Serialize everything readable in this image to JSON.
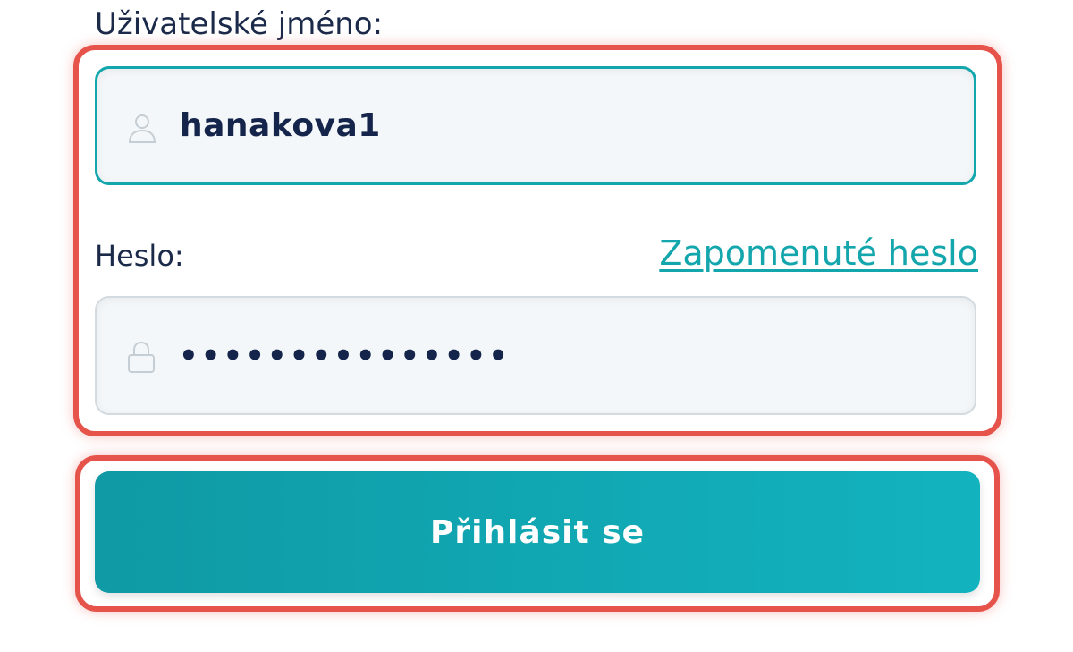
{
  "form": {
    "username_label": "Uživatelské jméno:",
    "username_value": "hanakova1",
    "password_label": "Heslo:",
    "forgot_password_link": "Zapomenuté heslo",
    "password_value": "•••••••••••••••",
    "login_button_label": "Přihlásit se"
  },
  "icons": {
    "username_field_icon": "user-icon",
    "password_field_icon": "lock-icon"
  },
  "colors": {
    "accent": "#14a6ad",
    "highlight": "#e5534b",
    "text_primary": "#1c2a4a"
  }
}
